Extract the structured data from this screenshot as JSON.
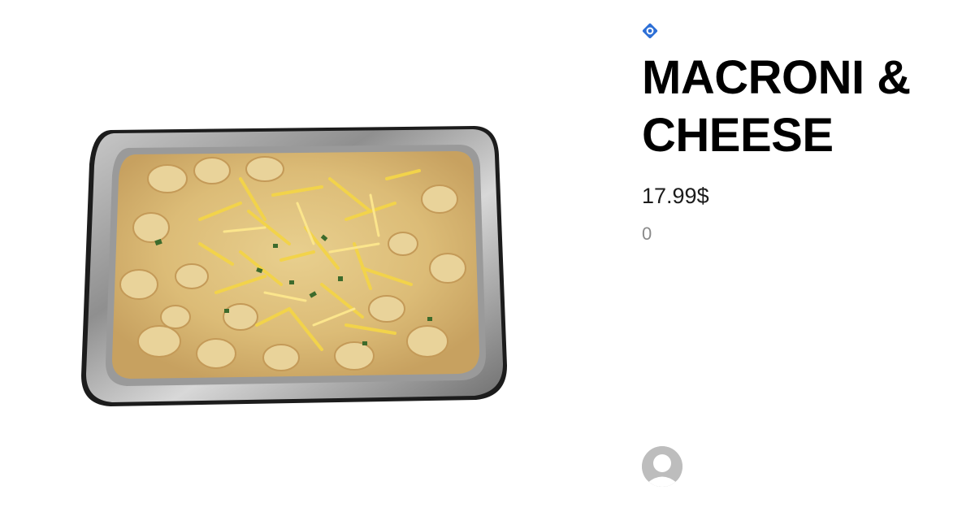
{
  "product": {
    "title": "MACRONI & CHEESE",
    "price": "17.99$",
    "count": "0"
  },
  "colors": {
    "brand_icon": "#2d6fd6",
    "title": "#000000",
    "price": "#1c1c1c",
    "count": "#8a8a8a",
    "avatar": "#bdbdbd"
  },
  "icons": {
    "brand": "diamond-pin-icon",
    "avatar": "user-silhouette-icon"
  }
}
